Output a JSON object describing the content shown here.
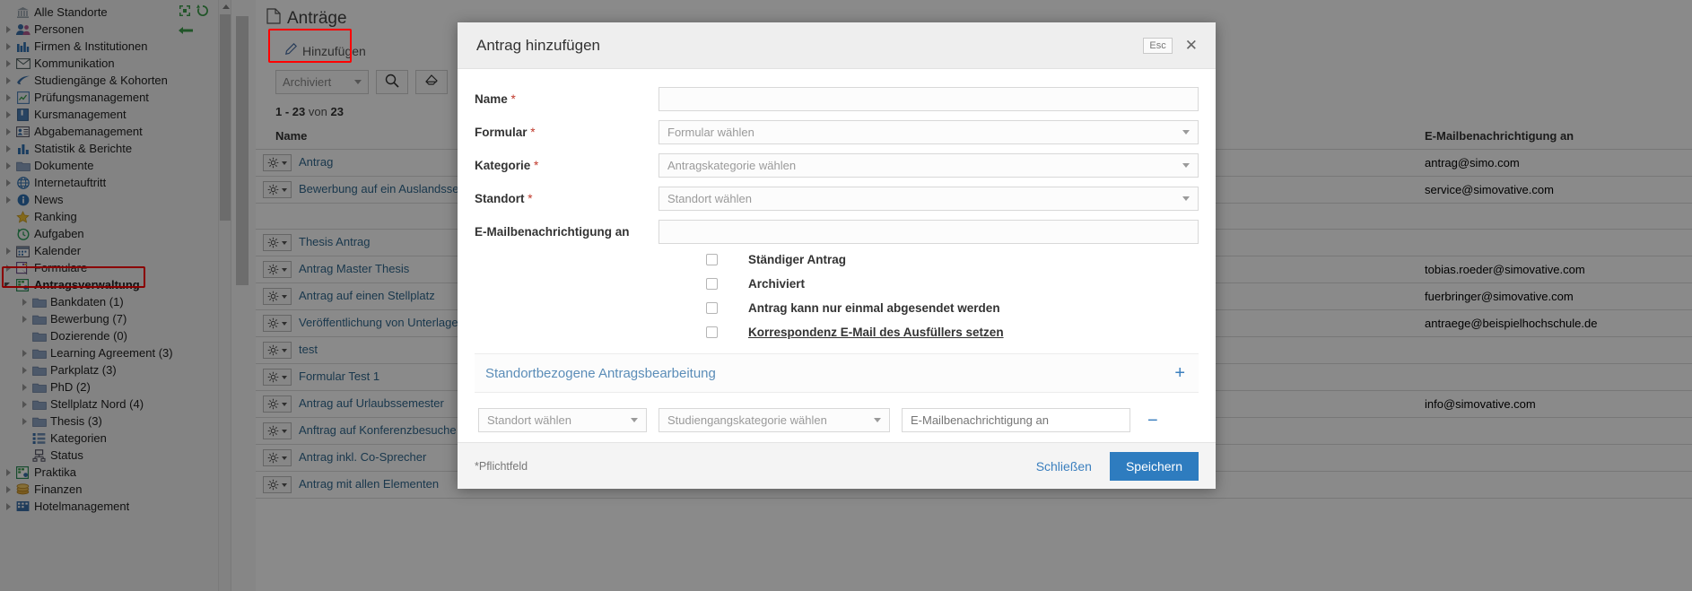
{
  "sidebar": {
    "tools": [
      {
        "name": "collapse-all-icon"
      },
      {
        "name": "refresh-icon"
      },
      {
        "name": "back-arrow-icon"
      }
    ],
    "items": [
      {
        "label": "Alle Standorte",
        "icon": "bank-icon",
        "arrow": "none",
        "indent": 1,
        "bold": false
      },
      {
        "label": "Personen",
        "icon": "people-icon",
        "arrow": "closed",
        "indent": 1,
        "bold": false
      },
      {
        "label": "Firmen & Institutionen",
        "icon": "factory-icon",
        "arrow": "closed",
        "indent": 1,
        "bold": false
      },
      {
        "label": "Kommunikation",
        "icon": "envelope-icon",
        "arrow": "closed",
        "indent": 1,
        "bold": false
      },
      {
        "label": "Studiengänge & Kohorten",
        "icon": "graduation-icon",
        "arrow": "closed",
        "indent": 1,
        "bold": false
      },
      {
        "label": "Prüfungsmanagement",
        "icon": "exam-icon",
        "arrow": "closed",
        "indent": 1,
        "bold": false
      },
      {
        "label": "Kursmanagement",
        "icon": "book-icon",
        "arrow": "closed",
        "indent": 1,
        "bold": false
      },
      {
        "label": "Abgabemanagement",
        "icon": "card-icon",
        "arrow": "closed",
        "indent": 1,
        "bold": false
      },
      {
        "label": "Statistik & Berichte",
        "icon": "barchart-icon",
        "arrow": "closed",
        "indent": 1,
        "bold": false
      },
      {
        "label": "Dokumente",
        "icon": "folder-icon",
        "arrow": "closed",
        "indent": 1,
        "bold": false
      },
      {
        "label": "Internetauftritt",
        "icon": "globe-icon",
        "arrow": "closed",
        "indent": 1,
        "bold": false
      },
      {
        "label": "News",
        "icon": "info-icon",
        "arrow": "closed",
        "indent": 1,
        "bold": false
      },
      {
        "label": "Ranking",
        "icon": "star-icon",
        "arrow": "none",
        "indent": 1,
        "bold": false
      },
      {
        "label": "Aufgaben",
        "icon": "clock-icon",
        "arrow": "none",
        "indent": 1,
        "bold": false
      },
      {
        "label": "Kalender",
        "icon": "calendar-icon",
        "arrow": "closed",
        "indent": 1,
        "bold": false
      },
      {
        "label": "Formulare",
        "icon": "form-icon",
        "arrow": "closed",
        "indent": 1,
        "bold": false
      },
      {
        "label": "Antragsverwaltung",
        "icon": "application-icon",
        "arrow": "open",
        "indent": 1,
        "bold": true
      },
      {
        "label": "Bankdaten (1)",
        "icon": "folder-icon",
        "arrow": "closed",
        "indent": 2,
        "bold": false
      },
      {
        "label": "Bewerbung (7)",
        "icon": "folder-icon",
        "arrow": "closed",
        "indent": 2,
        "bold": false
      },
      {
        "label": "Dozierende (0)",
        "icon": "folder-icon",
        "arrow": "none",
        "indent": 2,
        "bold": false
      },
      {
        "label": "Learning Agreement (3)",
        "icon": "folder-icon",
        "arrow": "closed",
        "indent": 2,
        "bold": false
      },
      {
        "label": "Parkplatz (3)",
        "icon": "folder-icon",
        "arrow": "closed",
        "indent": 2,
        "bold": false
      },
      {
        "label": "PhD (2)",
        "icon": "folder-icon",
        "arrow": "closed",
        "indent": 2,
        "bold": false
      },
      {
        "label": "Stellplatz Nord (4)",
        "icon": "folder-icon",
        "arrow": "closed",
        "indent": 2,
        "bold": false
      },
      {
        "label": "Thesis (3)",
        "icon": "folder-icon",
        "arrow": "closed",
        "indent": 2,
        "bold": false
      },
      {
        "label": "Kategorien",
        "icon": "categories-icon",
        "arrow": "none",
        "indent": 2,
        "bold": false
      },
      {
        "label": "Status",
        "icon": "status-icon",
        "arrow": "none",
        "indent": 2,
        "bold": false
      },
      {
        "label": "Praktika",
        "icon": "application-icon",
        "arrow": "closed",
        "indent": 1,
        "bold": false
      },
      {
        "label": "Finanzen",
        "icon": "coins-icon",
        "arrow": "closed",
        "indent": 1,
        "bold": false
      },
      {
        "label": "Hotelmanagement",
        "icon": "hotel-icon",
        "arrow": "closed",
        "indent": 1,
        "bold": false
      }
    ]
  },
  "main": {
    "page_title": "Anträge",
    "add_button": "Hinzufügen",
    "filter_select": "Archiviert",
    "search_icon": "search-icon",
    "clear_icon": "eraser-icon",
    "count_prefix": "1 - 23",
    "count_middle": "von",
    "count_total": "23",
    "columns": [
      "Name",
      "E-Mailbenachrichtigung an"
    ],
    "rows": [
      {
        "name": "Antrag",
        "email": "antrag@simo.com"
      },
      {
        "name": "Bewerbung auf ein Auslandssemester",
        "email": "service@simovative.com"
      },
      {
        "name": "",
        "email": ""
      },
      {
        "name": "Thesis Antrag",
        "email": ""
      },
      {
        "name": "Antrag Master Thesis",
        "email": "tobias.roeder@simovative.com"
      },
      {
        "name": "Antrag auf einen Stellplatz",
        "email": "fuerbringer@simovative.com"
      },
      {
        "name": "Veröffentlichung von Unterlagen",
        "email": "antraege@beispielhochschule.de"
      },
      {
        "name": "test",
        "email": ""
      },
      {
        "name": "Formular Test 1",
        "email": ""
      },
      {
        "name": "Antrag auf Urlaubssemester",
        "email": "info@simovative.com"
      },
      {
        "name": "Anftrag auf Konferenzbesuche",
        "email": ""
      },
      {
        "name": "Antrag inkl. Co-Sprecher",
        "email": ""
      },
      {
        "name": "Antrag mit allen Elementen",
        "email": ""
      }
    ]
  },
  "modal": {
    "title": "Antrag hinzufügen",
    "esc_label": "Esc",
    "close_icon": "close-icon",
    "fields": [
      {
        "label": "Name",
        "required": true,
        "type": "input",
        "value": "",
        "placeholder": ""
      },
      {
        "label": "Formular",
        "required": true,
        "type": "select",
        "value": "Formular wählen"
      },
      {
        "label": "Kategorie",
        "required": true,
        "type": "select",
        "value": "Antragskategorie wählen"
      },
      {
        "label": "Standort",
        "required": true,
        "type": "select",
        "value": "Standort wählen"
      },
      {
        "label": "E-Mailbenachrichtigung an",
        "required": false,
        "type": "input",
        "value": "",
        "placeholder": ""
      }
    ],
    "checkboxes": [
      {
        "label": "Ständiger Antrag",
        "checked": false,
        "underline": false
      },
      {
        "label": "Archiviert",
        "checked": false,
        "underline": false
      },
      {
        "label": "Antrag kann nur einmal abgesendet werden",
        "checked": false,
        "underline": false
      },
      {
        "label": "Korrespondenz E-Mail des Ausfüllers setzen",
        "checked": false,
        "underline": true
      }
    ],
    "section": {
      "title": "Standortbezogene Antragsbearbeitung",
      "add_icon": "plus-icon",
      "remove_icon": "minus-icon",
      "row": {
        "standort": "Standort wählen",
        "studiengangskategorie": "Studiengangskategorie wählen",
        "email_placeholder": "E-Mailbenachrichtigung an"
      }
    },
    "footer": {
      "note": "*Pflichtfeld",
      "close_label": "Schließen",
      "save_label": "Speichern"
    }
  },
  "colors": {
    "primary": "#2e7cbf",
    "link": "#31688e",
    "highlight": "#ff0000",
    "required": "#c0392b"
  }
}
